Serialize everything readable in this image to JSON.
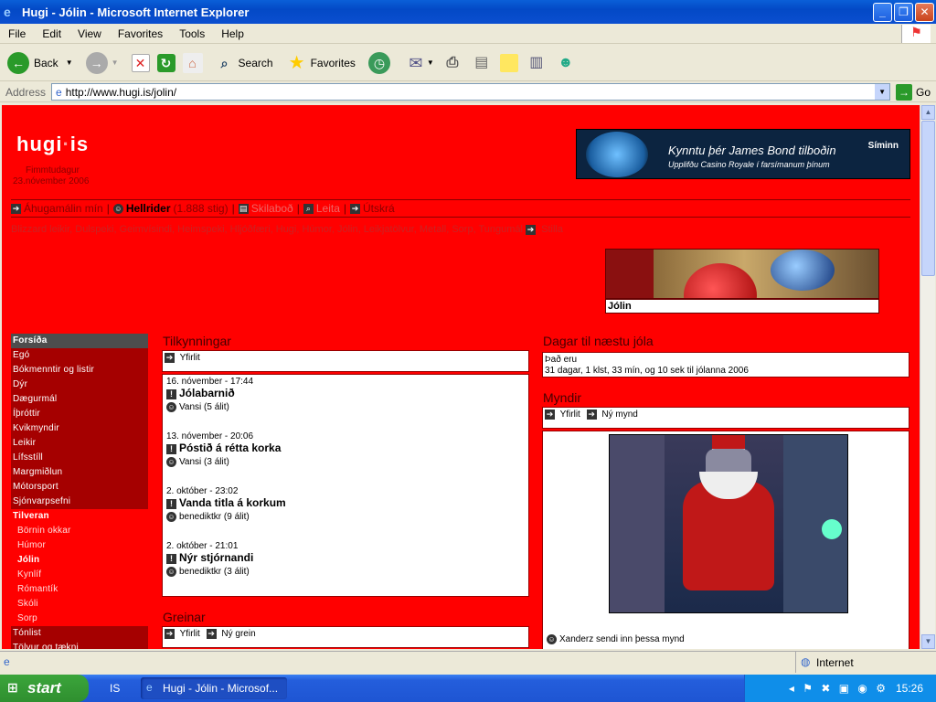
{
  "window": {
    "title": "Hugi - Jólin - Microsoft Internet Explorer",
    "menu": [
      "File",
      "Edit",
      "View",
      "Favorites",
      "Tools",
      "Help"
    ],
    "toolbar": {
      "back": "Back",
      "search": "Search",
      "favorites": "Favorites"
    },
    "address_label": "Address",
    "address_url": "http://www.hugi.is/jolin/",
    "go_label": "Go",
    "status_zone": "Internet"
  },
  "taskbar": {
    "start": "start",
    "quicklaunch": "IS",
    "task": "Hugi - Jólin - Microsof...",
    "clock": "15:26"
  },
  "site": {
    "logo_a": "hugi",
    "logo_b": "is",
    "day": "Fimmtudagur",
    "date": "23.nóvember 2006",
    "banner": {
      "line1": "Kynntu þér James Bond tilboðin",
      "line2": "Upplifðu Casino Royale í farsímanum þínum",
      "brand": "Síminn"
    },
    "userbar": {
      "my_interests": "Áhugamálin mín",
      "username": "Hellrider",
      "points": "(1.888 stig)",
      "messages": "Skilaboð",
      "search": "Leita",
      "logout": "Útskrá"
    },
    "topics": "Blizzard leikir, Dulspeki, Geimvísindi, Heimspeki, Hljóðfæri, Hugi, Húmor, Jólin, Leikjatölvur, Metall, Sorp, Tungumál",
    "topics_more": "Stilla",
    "xmas_label": "Jólin",
    "nav": [
      {
        "label": "Forsíða",
        "style": "dark"
      },
      {
        "label": "Egó",
        "style": ""
      },
      {
        "label": "Bókmenntir og listir",
        "style": ""
      },
      {
        "label": "Dýr",
        "style": ""
      },
      {
        "label": "Dægurmál",
        "style": ""
      },
      {
        "label": "Íþróttir",
        "style": ""
      },
      {
        "label": "Kvikmyndir",
        "style": ""
      },
      {
        "label": "Leikir",
        "style": ""
      },
      {
        "label": "Lífsstíll",
        "style": ""
      },
      {
        "label": "Margmiðlun",
        "style": ""
      },
      {
        "label": "Mótorsport",
        "style": ""
      },
      {
        "label": "Sjónvarpsefni",
        "style": ""
      },
      {
        "label": "Tilveran",
        "style": "subhead"
      },
      {
        "label": "Börnin okkar",
        "style": "sub"
      },
      {
        "label": "Húmor",
        "style": "sub"
      },
      {
        "label": "Jólin",
        "style": "subcur"
      },
      {
        "label": "Kynlíf",
        "style": "sub"
      },
      {
        "label": "Rómantík",
        "style": "sub"
      },
      {
        "label": "Skóli",
        "style": "sub"
      },
      {
        "label": "Sorp",
        "style": "sub"
      },
      {
        "label": "Tónlist",
        "style": ""
      },
      {
        "label": "Tölvur og tækni",
        "style": ""
      }
    ],
    "announcements": {
      "title": "Tilkynningar",
      "overview": "Yfirlit",
      "items": [
        {
          "date": "16. nóvember - 17:44",
          "title": "Jólabarnið",
          "author": "Vansi (5 álit)"
        },
        {
          "date": "13. nóvember - 20:06",
          "title": "Póstið á rétta korka",
          "author": "Vansi (3 álit)"
        },
        {
          "date": "2. október - 23:02",
          "title": "Vanda titla á korkum",
          "author": "benediktkr (9 álit)"
        },
        {
          "date": "2. október - 21:01",
          "title": "Nýr stjórnandi",
          "author": "benediktkr (3 álit)"
        }
      ]
    },
    "articles": {
      "title": "Greinar",
      "overview": "Yfirlit",
      "new": "Ný grein"
    },
    "countdown": {
      "title": "Dagar til næstu jóla",
      "line1": "Það eru",
      "line2": "31 dagar, 1 klst, 33 mín, og 10 sek til jólanna 2006"
    },
    "pictures": {
      "title": "Myndir",
      "overview": "Yfirlit",
      "new": "Ný mynd",
      "caption": "Xanderz sendi inn þessa mynd"
    }
  }
}
